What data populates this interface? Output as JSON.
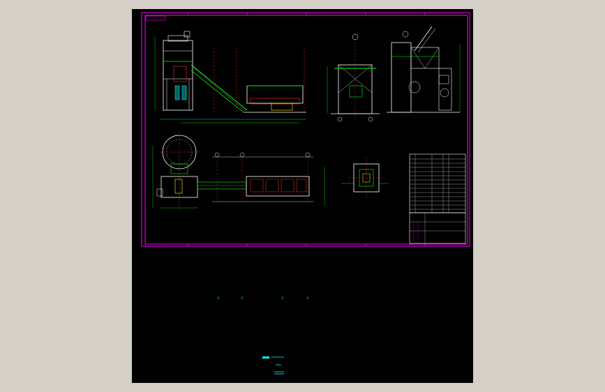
{
  "viewer": {
    "background_color": "#d4d0c8"
  },
  "drawing": {
    "background_color": "#000000",
    "frame_color": "#ff00ff",
    "line_colors": {
      "structure": "#ffffff",
      "conveyor": "#00ff00",
      "centerline": "#ff3030",
      "equipment": "#ffff00",
      "dimension": "#00ffff"
    },
    "sheet_tag": "",
    "title_block": {
      "title": "",
      "sheet_no": ""
    },
    "parts_table": {
      "title": "",
      "rows": [
        "",
        "",
        "",
        "",
        "",
        "",
        "",
        "",
        "",
        "",
        "",
        "",
        ""
      ]
    },
    "stamp": {
      "line1": "",
      "line2": ""
    }
  }
}
